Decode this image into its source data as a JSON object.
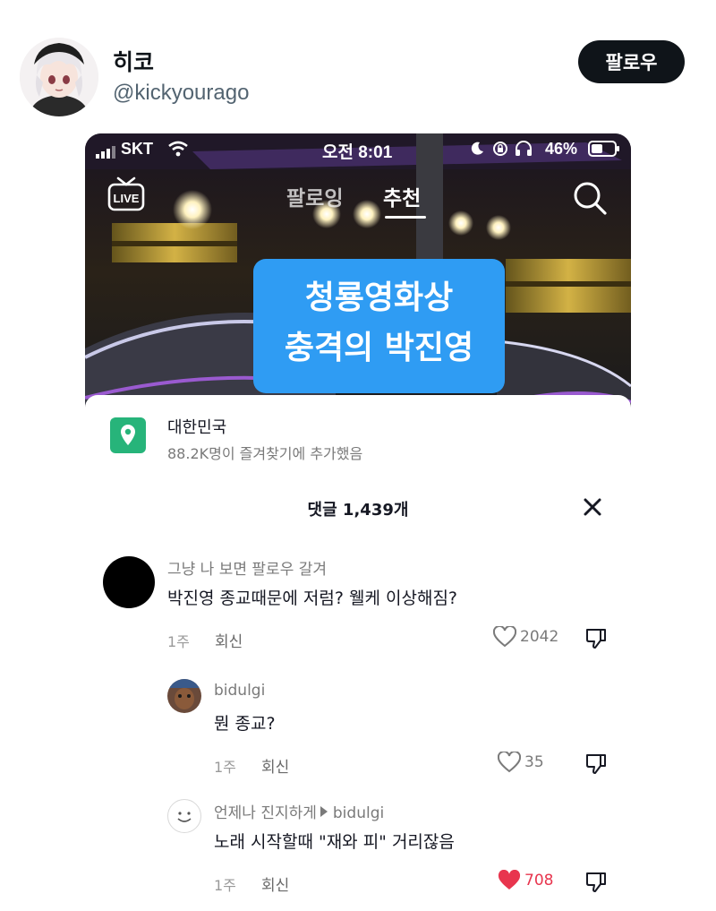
{
  "tweet": {
    "display_name": "히코",
    "handle": "@kickyourago",
    "follow_label": "팔로우"
  },
  "status_bar": {
    "carrier": "SKT",
    "time": "오전 8:01",
    "battery": "46%"
  },
  "feed": {
    "tabs": [
      {
        "label": "팔로잉",
        "active": false
      },
      {
        "label": "추천",
        "active": true
      }
    ],
    "live_label": "LIVE",
    "caption_lines": [
      "청룡영화상",
      "충격의 박진영"
    ]
  },
  "location": {
    "title": "대한민국",
    "subtitle": "88.2K명이 즐겨찾기에 추가했음"
  },
  "comments_header": "댓글 1,439개",
  "comments": [
    {
      "user": "그냥 나 보면 팔로우 갈겨",
      "text": "박진영 종교때문에 저럼? 웰케 이상해짐?",
      "time": "1주",
      "reply_label": "회신",
      "likes": "2042",
      "liked": false
    },
    {
      "user": "bidulgi",
      "text": "뭔 종교?",
      "time": "1주",
      "reply_label": "회신",
      "likes": "35",
      "liked": false
    },
    {
      "user": "언제나 진지하게",
      "reply_to": "bidulgi",
      "text": "노래 시작할때 \"재와 피\" 거리잖음",
      "time": "1주",
      "reply_label": "회신",
      "likes": "708",
      "liked": true
    }
  ],
  "colors": {
    "follow_button": "#0f1419",
    "caption_bg": "#2f9cf3",
    "location_icon": "#27b47a",
    "liked_heart": "#e8354e"
  }
}
